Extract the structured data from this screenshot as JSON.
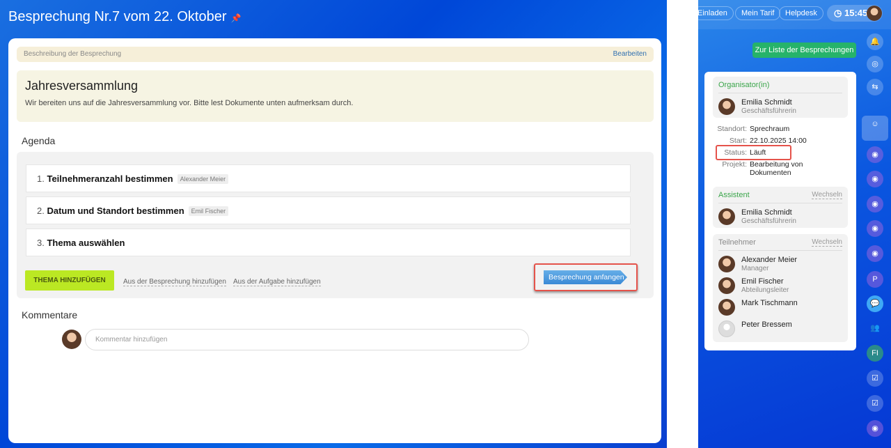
{
  "header": {
    "title": "Besprechung Nr.7 vom 22. Oktober"
  },
  "description": {
    "bar_label": "Beschreibung der Besprechung",
    "edit_label": "Bearbeiten",
    "heading": "Jahresversammlung",
    "text": "Wir bereiten uns auf die Jahresversammlung vor. Bitte lest Dokumente unten aufmerksam durch."
  },
  "agenda": {
    "title": "Agenda",
    "items": [
      {
        "num": "1.",
        "title": "Teilnehmeranzahl bestimmen",
        "tag": "Alexander Meier"
      },
      {
        "num": "2.",
        "title": "Datum und Standort bestimmen",
        "tag": "Emil Fischer"
      },
      {
        "num": "3.",
        "title": "Thema auswählen"
      }
    ],
    "add_topic": "THEMA HINZUFÜGEN",
    "from_meeting": "Aus der Besprechung hinzufügen",
    "from_task": "Aus der Aufgabe hinzufügen",
    "start": "Besprechung anfangen"
  },
  "comments": {
    "title": "Kommentare",
    "placeholder": "Kommentar hinzufügen"
  },
  "topbar": {
    "invite": "Einladen",
    "plan": "Mein Tarif",
    "helpdesk": "Helpdesk",
    "time": "15:45"
  },
  "list_button": "Zur Liste der Besprechungen",
  "details": {
    "organizer_label": "Organisator(in)",
    "organizer": {
      "name": "Emilia Schmidt",
      "role": "Geschäftsführerin"
    },
    "location_label": "Standort:",
    "location": "Sprechraum",
    "start_label": "Start:",
    "start": "22.10.2025 14:00",
    "status_label": "Status:",
    "status": "Läuft",
    "project_label": "Projekt:",
    "project": "Bearbeitung von Dokumenten",
    "assistant_label": "Assistent",
    "change": "Wechseln",
    "assistant": {
      "name": "Emilia Schmidt",
      "role": "Geschäftsführerin"
    },
    "participants_label": "Teilnehmer",
    "participants": [
      {
        "name": "Alexander Meier",
        "role": "Manager"
      },
      {
        "name": "Emil Fischer",
        "role": "Abteilungsleiter"
      },
      {
        "name": "Mark Tischmann",
        "role": ""
      },
      {
        "name": "Peter Bressem",
        "role": ""
      }
    ]
  },
  "sidebar": {
    "p_label": "P",
    "fi_label": "FI"
  }
}
